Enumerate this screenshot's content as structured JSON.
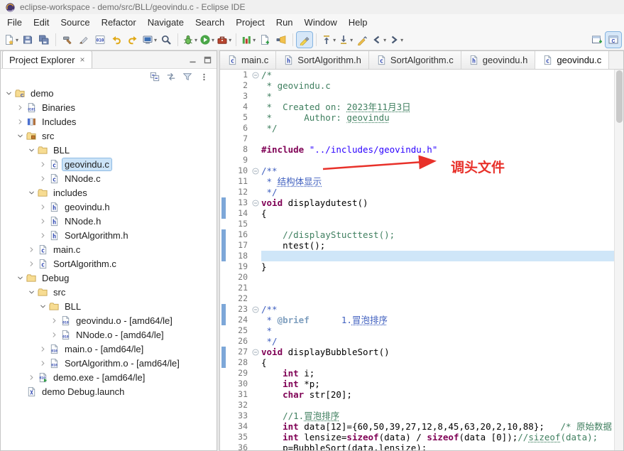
{
  "window": {
    "title": "eclipse-workspace - demo/src/BLL/geovindu.c - Eclipse IDE"
  },
  "menubar": [
    "File",
    "Edit",
    "Source",
    "Refactor",
    "Navigate",
    "Search",
    "Project",
    "Run",
    "Window",
    "Help"
  ],
  "toolbar": {
    "left": [
      {
        "name": "new-wizard",
        "dd": true
      },
      {
        "name": "save"
      },
      {
        "name": "save-all"
      },
      {
        "sep": true
      },
      {
        "name": "build-all"
      },
      {
        "name": "knife"
      },
      {
        "name": "binary"
      },
      {
        "name": "undo"
      },
      {
        "name": "redo"
      },
      {
        "name": "open-console",
        "dd": true
      },
      {
        "name": "search"
      },
      {
        "sep": true
      },
      {
        "name": "debug",
        "dd": true
      },
      {
        "name": "run",
        "dd": true
      },
      {
        "name": "external-tools",
        "dd": true
      },
      {
        "sep": true
      },
      {
        "name": "coverage",
        "dd": true
      },
      {
        "name": "new-cpp"
      },
      {
        "name": "open-element"
      },
      {
        "sep": true
      },
      {
        "name": "mark-occurrences",
        "active": true
      },
      {
        "sep": true
      },
      {
        "name": "previous-annotation",
        "dd": true
      },
      {
        "name": "next-annotation",
        "dd": true
      },
      {
        "name": "last-edit-location"
      },
      {
        "name": "back",
        "dd": true
      },
      {
        "name": "forward",
        "dd": true
      }
    ],
    "right": [
      {
        "name": "open-perspective"
      },
      {
        "name": "cpp-perspective",
        "active": true
      }
    ]
  },
  "explorer": {
    "title": "Project Explorer",
    "close": "×",
    "header_tools": [
      "minimize",
      "maximize"
    ],
    "tools": [
      "collapse-all",
      "link-with-editor",
      "filter",
      "view-menu"
    ],
    "tree": [
      {
        "depth": 0,
        "arrow": "open",
        "icon": "project",
        "label": "demo"
      },
      {
        "depth": 1,
        "arrow": "closed",
        "icon": "binaries",
        "label": "Binaries"
      },
      {
        "depth": 1,
        "arrow": "closed",
        "icon": "includes",
        "label": "Includes"
      },
      {
        "depth": 1,
        "arrow": "open",
        "icon": "src-folder",
        "label": "src"
      },
      {
        "depth": 2,
        "arrow": "open",
        "icon": "folder",
        "label": "BLL"
      },
      {
        "depth": 3,
        "arrow": "closed",
        "icon": "c-file",
        "label": "geovindu.c",
        "selected": true
      },
      {
        "depth": 3,
        "arrow": "closed",
        "icon": "c-file",
        "label": "NNode.c"
      },
      {
        "depth": 2,
        "arrow": "open",
        "icon": "folder",
        "label": "includes"
      },
      {
        "depth": 3,
        "arrow": "closed",
        "icon": "h-file",
        "label": "geovindu.h"
      },
      {
        "depth": 3,
        "arrow": "closed",
        "icon": "h-file",
        "label": "NNode.h"
      },
      {
        "depth": 3,
        "arrow": "closed",
        "icon": "h-file",
        "label": "SortAlgorithm.h"
      },
      {
        "depth": 2,
        "arrow": "closed",
        "icon": "c-file",
        "label": "main.c"
      },
      {
        "depth": 2,
        "arrow": "closed",
        "icon": "c-file",
        "label": "SortAlgorithm.c"
      },
      {
        "depth": 1,
        "arrow": "open",
        "icon": "folder",
        "label": "Debug"
      },
      {
        "depth": 2,
        "arrow": "open",
        "icon": "folder",
        "label": "src"
      },
      {
        "depth": 3,
        "arrow": "open",
        "icon": "folder",
        "label": "BLL"
      },
      {
        "depth": 4,
        "arrow": "closed",
        "icon": "obj-file",
        "label": "geovindu.o - [amd64/le]"
      },
      {
        "depth": 4,
        "arrow": "closed",
        "icon": "obj-file",
        "label": "NNode.o - [amd64/le]"
      },
      {
        "depth": 3,
        "arrow": "closed",
        "icon": "obj-file",
        "label": "main.o - [amd64/le]"
      },
      {
        "depth": 3,
        "arrow": "closed",
        "icon": "obj-file",
        "label": "SortAlgorithm.o - [amd64/le]"
      },
      {
        "depth": 2,
        "arrow": "closed",
        "icon": "exe-file",
        "label": "demo.exe - [amd64/le]"
      },
      {
        "depth": 1,
        "arrow": null,
        "icon": "launch-file",
        "label": "demo Debug.launch"
      }
    ]
  },
  "editor": {
    "tabs": [
      {
        "label": "main.c",
        "icon": "c-file",
        "active": false
      },
      {
        "label": "SortAlgorithm.h",
        "icon": "h-file",
        "active": false
      },
      {
        "label": "SortAlgorithm.c",
        "icon": "c-file",
        "active": false
      },
      {
        "label": "geovindu.h",
        "icon": "h-file",
        "active": false
      },
      {
        "label": "geovindu.c",
        "icon": "c-file",
        "active": true
      }
    ],
    "active_line": 18,
    "fold_lines": [
      1,
      10,
      13,
      23,
      27
    ],
    "ruler_marks": [
      [
        13,
        14
      ],
      [
        16,
        18
      ],
      [
        23,
        24
      ],
      [
        27,
        28
      ]
    ],
    "annotation": {
      "text": "调头文件",
      "color": "#e8312a"
    },
    "lines": [
      {
        "n": 1,
        "segs": [
          [
            "/*",
            "cm"
          ]
        ]
      },
      {
        "n": 2,
        "segs": [
          [
            " * geovindu.c",
            "cm"
          ]
        ]
      },
      {
        "n": 3,
        "segs": [
          [
            " *",
            "cm"
          ]
        ]
      },
      {
        "n": 4,
        "segs": [
          [
            " *  Created on: ",
            "cm"
          ],
          [
            "2023年11月3日",
            "cm u"
          ]
        ]
      },
      {
        "n": 5,
        "segs": [
          [
            " *      Author: ",
            "cm"
          ],
          [
            "geovindu",
            "cm u"
          ]
        ]
      },
      {
        "n": 6,
        "segs": [
          [
            " */",
            "cm"
          ]
        ]
      },
      {
        "n": 7,
        "segs": []
      },
      {
        "n": 8,
        "segs": [
          [
            "#include ",
            "kw"
          ],
          [
            "\"../includes/geovindu.h\"",
            "str"
          ]
        ]
      },
      {
        "n": 9,
        "segs": []
      },
      {
        "n": 10,
        "segs": [
          [
            "/**",
            "doc"
          ]
        ]
      },
      {
        "n": 11,
        "segs": [
          [
            " * ",
            "doc"
          ],
          [
            "结构体显示",
            "doc u"
          ]
        ]
      },
      {
        "n": 12,
        "segs": [
          [
            " */",
            "doc"
          ]
        ]
      },
      {
        "n": 13,
        "segs": [
          [
            "void",
            "kw"
          ],
          [
            " displaydutest()",
            "pl"
          ]
        ]
      },
      {
        "n": 14,
        "segs": [
          [
            "{",
            "pl"
          ]
        ]
      },
      {
        "n": 15,
        "segs": []
      },
      {
        "n": 16,
        "segs": [
          [
            "    ",
            "pl"
          ],
          [
            "//displayStucttest();",
            "cm"
          ]
        ]
      },
      {
        "n": 17,
        "segs": [
          [
            "    ntest();",
            "pl"
          ]
        ]
      },
      {
        "n": 18,
        "segs": []
      },
      {
        "n": 19,
        "segs": [
          [
            "}",
            "pl"
          ]
        ]
      },
      {
        "n": 20,
        "segs": []
      },
      {
        "n": 21,
        "segs": []
      },
      {
        "n": 22,
        "segs": []
      },
      {
        "n": 23,
        "segs": [
          [
            "/**",
            "doc"
          ]
        ]
      },
      {
        "n": 24,
        "segs": [
          [
            " * ",
            "doc"
          ],
          [
            "@brief",
            "doctag"
          ],
          [
            "      1.",
            "doc"
          ],
          [
            "冒泡排序",
            "doc u"
          ]
        ]
      },
      {
        "n": 25,
        "segs": [
          [
            " *",
            "doc"
          ]
        ]
      },
      {
        "n": 26,
        "segs": [
          [
            " */",
            "doc"
          ]
        ]
      },
      {
        "n": 27,
        "segs": [
          [
            "void",
            "kw"
          ],
          [
            " displayBubbleSort()",
            "pl"
          ]
        ]
      },
      {
        "n": 28,
        "segs": [
          [
            "{",
            "pl"
          ]
        ]
      },
      {
        "n": 29,
        "segs": [
          [
            "    ",
            "pl"
          ],
          [
            "int",
            "kw"
          ],
          [
            " i;",
            "pl"
          ]
        ]
      },
      {
        "n": 30,
        "segs": [
          [
            "    ",
            "pl"
          ],
          [
            "int",
            "kw"
          ],
          [
            " *p;",
            "pl"
          ]
        ]
      },
      {
        "n": 31,
        "segs": [
          [
            "    ",
            "pl"
          ],
          [
            "char",
            "kw"
          ],
          [
            " str[20];",
            "pl"
          ]
        ]
      },
      {
        "n": 32,
        "segs": []
      },
      {
        "n": 33,
        "segs": [
          [
            "    ",
            "pl"
          ],
          [
            "//1.",
            "cm"
          ],
          [
            "冒泡排序",
            "cm u"
          ]
        ]
      },
      {
        "n": 34,
        "segs": [
          [
            "    ",
            "pl"
          ],
          [
            "int",
            "kw"
          ],
          [
            " data[12]={60,50,39,27,12,8,45,63,20,2,10,88};   ",
            "pl"
          ],
          [
            "/* 原始数据 */",
            "cm"
          ]
        ]
      },
      {
        "n": 35,
        "segs": [
          [
            "    ",
            "pl"
          ],
          [
            "int",
            "kw"
          ],
          [
            " lensize=",
            "pl"
          ],
          [
            "sizeof",
            "kw"
          ],
          [
            "(data) / ",
            "pl"
          ],
          [
            "sizeof",
            "kw"
          ],
          [
            "(data [0]);",
            "pl"
          ],
          [
            "//",
            "cm"
          ],
          [
            "sizeof",
            "cm u"
          ],
          [
            "(data);",
            "cm"
          ]
        ]
      },
      {
        "n": 36,
        "segs": [
          [
            "    p=BubbleSort(data,lensize);",
            "pl"
          ]
        ]
      }
    ]
  },
  "colors": {
    "keyword": "#7f0055",
    "comment": "#3f7f5f",
    "doc_comment": "#3f5fbf",
    "string": "#2a00ff",
    "annotation_red": "#e8312a",
    "selection": "#cbe3f7",
    "current_line": "#cfe6f8"
  }
}
